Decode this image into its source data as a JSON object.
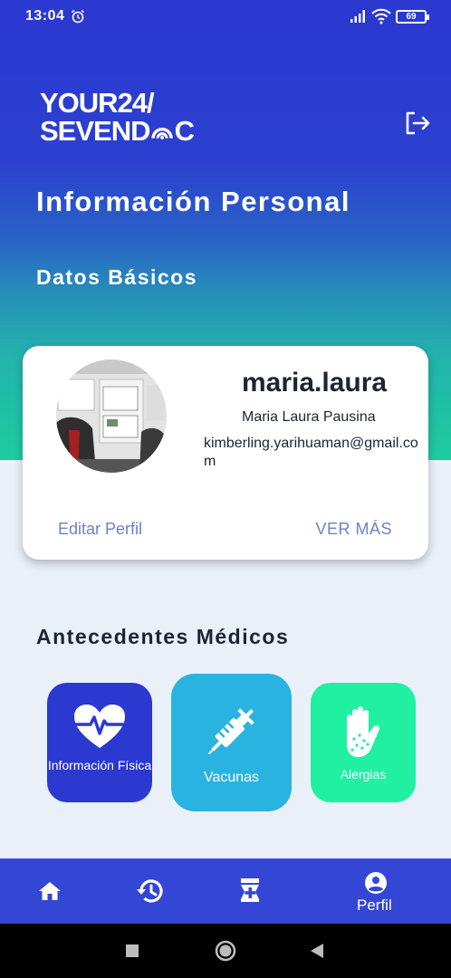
{
  "status_bar": {
    "time": "13:04",
    "battery": "69",
    "icons": [
      "alarm-icon",
      "signal-icon",
      "wifi-icon",
      "battery-icon"
    ]
  },
  "header": {
    "logo_line1": "YOUR24/",
    "logo_line2_prefix": "SEVEND",
    "logo_line2_suffix": "C",
    "logout_icon": "logout-icon"
  },
  "page": {
    "title": "Información Personal",
    "basic_section_title": "Datos Básicos"
  },
  "profile_card": {
    "username": "maria.laura",
    "full_name": "Maria Laura Pausina",
    "email": "kimberling.yarihuaman@gmail.com",
    "edit_label": "Editar Perfil",
    "more_label": "VER MÁS"
  },
  "medical": {
    "title": "Antecedentes Médicos",
    "tiles": [
      {
        "label": "Información Física",
        "icon": "heart-pulse-icon",
        "color": "#2b39d1"
      },
      {
        "label": "Vacunas",
        "icon": "syringe-icon",
        "color": "#29b3e0"
      },
      {
        "label": "Alergias",
        "icon": "allergy-hand-icon",
        "color": "#1ff0a2"
      }
    ]
  },
  "bottom_nav": {
    "items": [
      {
        "icon": "home-icon"
      },
      {
        "icon": "history-icon"
      },
      {
        "icon": "medicine-icon"
      },
      {
        "icon": "profile-icon",
        "label": "Perfil"
      }
    ]
  },
  "colors": {
    "primary": "#2b39d1",
    "accent_teal": "#1ecc9f",
    "link": "#6d82c6",
    "background": "#eaf0f8"
  }
}
